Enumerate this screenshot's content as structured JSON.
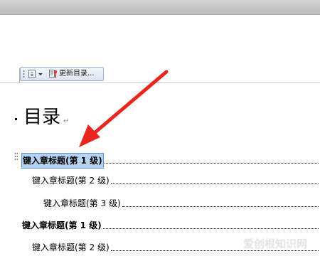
{
  "toolbar": {
    "update_label": "更新目录...",
    "icons": [
      "toc-document-icon",
      "update-toc-icon"
    ]
  },
  "document": {
    "title": "目录",
    "toc_entries": [
      {
        "level": 1,
        "text": "键入章标题(第 1 级)",
        "selected": true
      },
      {
        "level": 2,
        "text": "键入章标题(第 2 级)",
        "selected": false
      },
      {
        "level": 3,
        "text": "键入章标题(第 3 级)",
        "selected": false
      },
      {
        "level": 1,
        "text": "键入章标题(第 1 级)",
        "selected": false
      },
      {
        "level": 2,
        "text": "键入章标题(第 2 级)",
        "selected": false
      }
    ]
  },
  "annotation": {
    "arrow_color": "#e8261f"
  },
  "watermark": {
    "text": "爱创根知识网"
  },
  "colors": {
    "selection": "#b5d3f3",
    "toolbar_border": "#9fb0c8",
    "arrow": "#e8261f"
  }
}
